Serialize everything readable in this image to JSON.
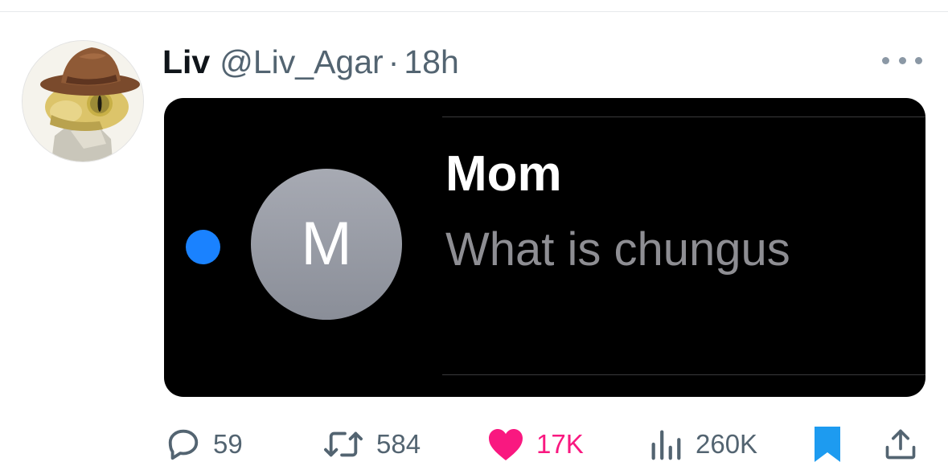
{
  "tweet": {
    "author": {
      "display_name": "Liv",
      "handle": "@Liv_Agar",
      "separator": "·",
      "time": "18h"
    },
    "media": {
      "sender": "Mom",
      "avatar_initial": "M",
      "preview": "What is chungus"
    },
    "actions": {
      "replies": "59",
      "retweets": "584",
      "likes": "17K",
      "views": "260K"
    }
  },
  "colors": {
    "accent": "#1d9bf0",
    "like": "#f91880",
    "secondary_text": "#536471",
    "unread_dot": "#1a82ff"
  },
  "icons": [
    "more-icon",
    "reply-icon",
    "retweet-icon",
    "like-icon",
    "views-icon",
    "bookmark-icon",
    "share-icon"
  ]
}
